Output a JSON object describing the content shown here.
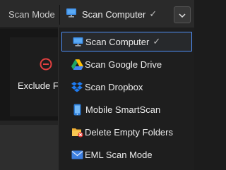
{
  "toolbar": {
    "scan_mode_label": "Scan Mode",
    "current_mode": "Scan Computer",
    "check_mark": "✓"
  },
  "background": {
    "exclude_button_label": "Exclude Fo"
  },
  "menu": {
    "items": [
      {
        "label": "Scan Computer",
        "icon": "monitor-icon",
        "selected": true
      },
      {
        "label": "Scan Google Drive",
        "icon": "google-drive-icon",
        "selected": false
      },
      {
        "label": "Scan Dropbox",
        "icon": "dropbox-icon",
        "selected": false
      },
      {
        "label": "Mobile SmartScan",
        "icon": "smartphone-icon",
        "selected": false
      },
      {
        "label": "Delete Empty Folders",
        "icon": "folder-delete-icon",
        "selected": false
      },
      {
        "label": "EML Scan Mode",
        "icon": "envelope-icon",
        "selected": false
      }
    ]
  },
  "colors": {
    "selection_border": "#4f8ff7",
    "menu_background": "#1e1e1e",
    "toolbar_background": "#2a2a2a"
  }
}
